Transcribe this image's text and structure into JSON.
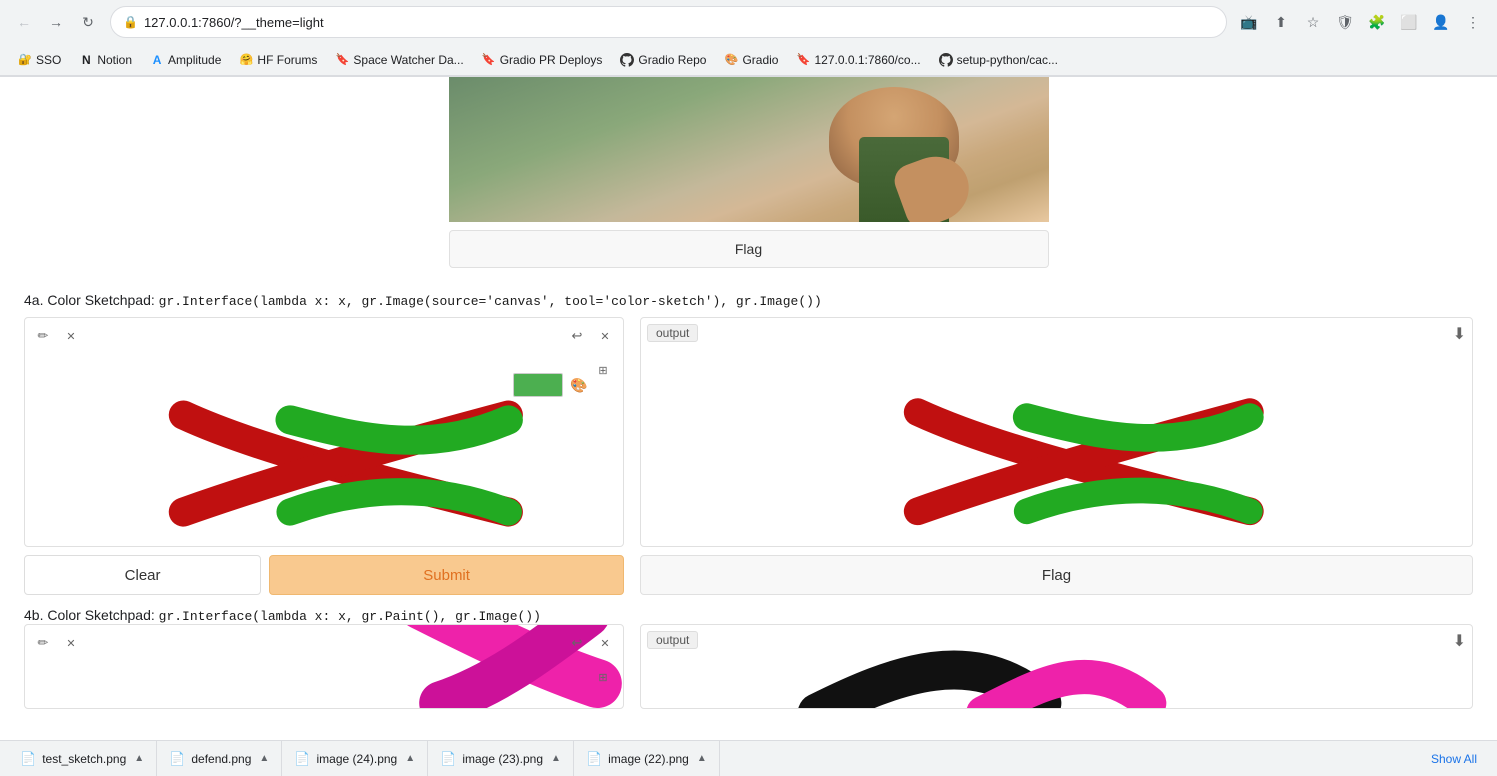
{
  "browser": {
    "url": "127.0.0.1:7860/?__theme=light",
    "back_disabled": true,
    "forward_disabled": false
  },
  "bookmarks": [
    {
      "id": "sso",
      "label": "SSO",
      "icon": "🔐"
    },
    {
      "id": "notion",
      "label": "Notion",
      "icon": "N"
    },
    {
      "id": "amplitude",
      "label": "Amplitude",
      "icon": "A"
    },
    {
      "id": "hf-forums",
      "label": "HF Forums",
      "icon": "🤗"
    },
    {
      "id": "space-watcher",
      "label": "Space Watcher Da...",
      "icon": "🔖"
    },
    {
      "id": "gradio-pr",
      "label": "Gradio PR Deploys",
      "icon": "🔖"
    },
    {
      "id": "gradio-repo",
      "label": "Gradio Repo",
      "icon": "🐙"
    },
    {
      "id": "gradio",
      "label": "Gradio",
      "icon": "🎨"
    },
    {
      "id": "local",
      "label": "127.0.0.1:7860/co...",
      "icon": "🔖"
    },
    {
      "id": "setup-python",
      "label": "setup-python/cac...",
      "icon": "🐙"
    }
  ],
  "top_image": {
    "alt": "Person with hand near face"
  },
  "flag_button_top": {
    "label": "Flag"
  },
  "section_4a": {
    "label": "4a. Color Sketchpad:",
    "code": "gr.Interface(lambda x: x, gr.Image(source='canvas', tool='color-sketch'), gr.Image())"
  },
  "canvas_4a": {
    "output_label": "output"
  },
  "buttons_4a": {
    "clear": "Clear",
    "submit": "Submit",
    "flag": "Flag"
  },
  "section_4b": {
    "label": "4b. Color Sketchpad:",
    "code": "gr.Interface(lambda x: x, gr.Paint(), gr.Image())"
  },
  "canvas_4b": {
    "output_label": "output"
  },
  "downloads": [
    {
      "name": "test_sketch.png"
    },
    {
      "name": "defend.png"
    },
    {
      "name": "image (24).png"
    },
    {
      "name": "image (23).png"
    },
    {
      "name": "image (22).png"
    }
  ],
  "show_all_label": "Show All",
  "colors": {
    "submit_bg": "#f9c98f",
    "submit_text": "#e07020",
    "submit_border": "#f0b870",
    "green_stroke": "#3db843",
    "red_stroke": "#c41e1e",
    "color_swatch": "#4caf50"
  }
}
